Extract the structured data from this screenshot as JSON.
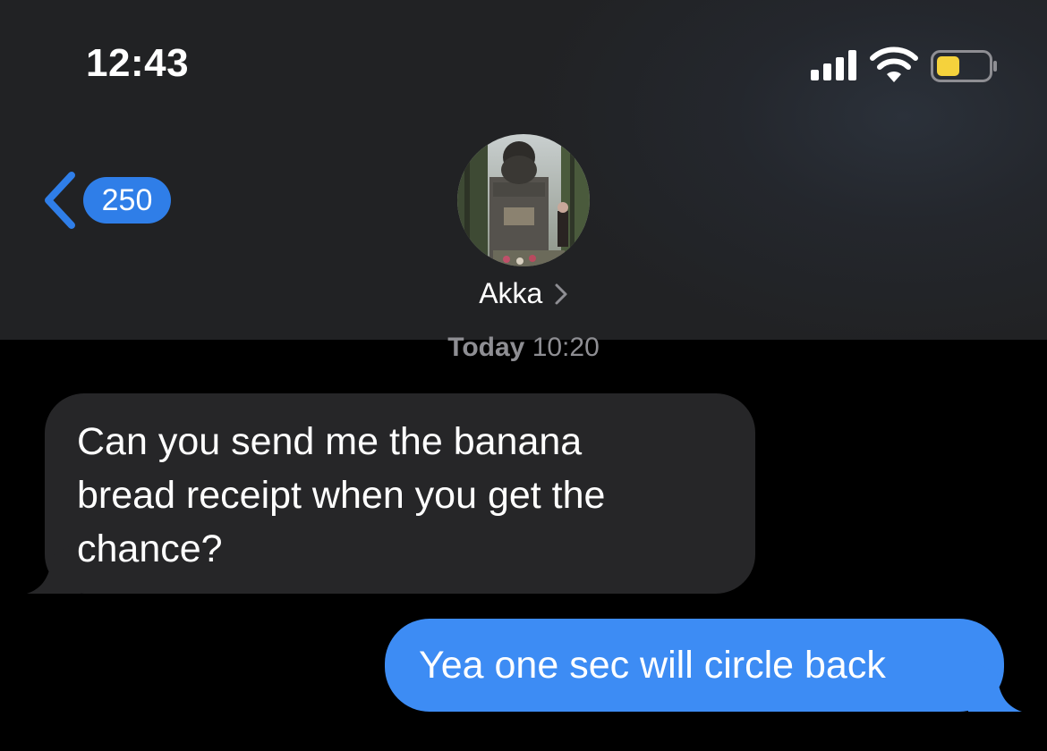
{
  "status_bar": {
    "time": "12:43",
    "signal_icon": "cellular-signal-icon",
    "wifi_icon": "wifi-icon",
    "battery_icon": "battery-icon",
    "battery_level": 0.45,
    "battery_color": "#f5d23c"
  },
  "header": {
    "back_icon": "chevron-left-icon",
    "unread_count": "250",
    "contact_name": "Akka",
    "accent_color": "#2f7ee8"
  },
  "conversation": {
    "timestamp_day": "Today",
    "timestamp_time": "10:20",
    "messages": [
      {
        "direction": "incoming",
        "lines": [
          "Can you send me the banana",
          "bread receipt when you get the",
          "chance?"
        ],
        "bubble_color": "#262628"
      },
      {
        "direction": "outgoing",
        "text": "Yea one sec will circle back",
        "bubble_color": "#3d8cf4"
      }
    ]
  }
}
